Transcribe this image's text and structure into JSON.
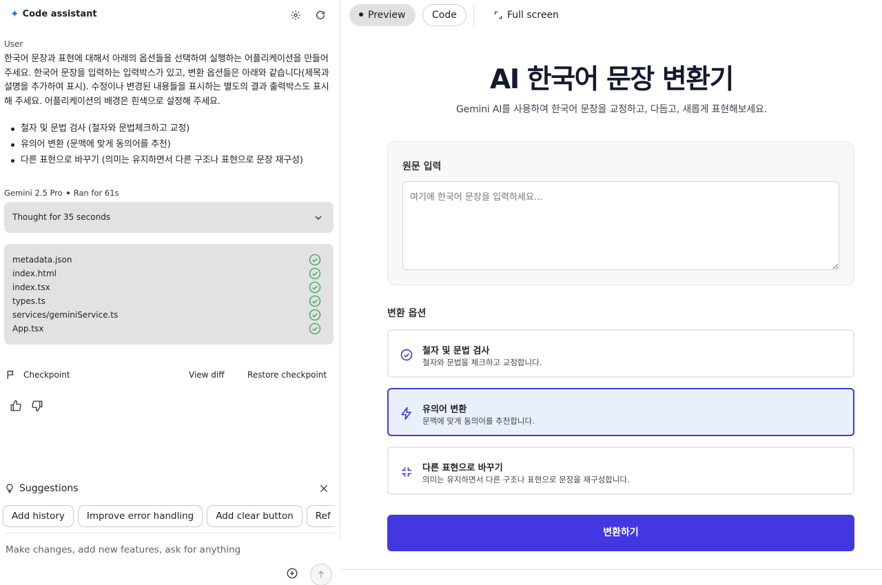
{
  "left": {
    "header": {
      "title": "Code assistant",
      "icons": [
        "settings-icon",
        "refresh-icon"
      ]
    },
    "user_label": "User",
    "user_message": "한국어 문장과 표현에 대해서 아래의 옵션들을 선택하여 실행하는 어플리케이션을 만들어 주세요. 한국어 문장을 입력하는 입력박스가 있고, 변환 옵션들은 아래와 같습니다(제목과 설명을 추가하여 표시). 수정이나 변경된 내용들을 표시하는 별도의 결과 출력박스도 표시해 주세요. 어플리케이션의 배경은 흰색으로 설정해 주세요.",
    "user_list": [
      "철자 및 문법 검사 (철자와 문법체크하고 교정)",
      "유의어 변환 (문맥에 맞게 동의어를 추천)",
      "다른 표현으로 바꾸기 (의미는 유지하면서 다른 구조나 표현으로 문장 재구성)"
    ],
    "model": "Gemini 2.5 Pro",
    "ran_for": "Ran for 61s",
    "thought": "Thought for 35 seconds",
    "files": [
      "metadata.json",
      "index.html",
      "index.tsx",
      "types.ts",
      "services/geminiService.ts",
      "App.tsx"
    ],
    "checkpoint": {
      "label": "Checkpoint",
      "view_diff": "View diff",
      "restore": "Restore checkpoint"
    },
    "suggestions": {
      "label": "Suggestions",
      "chips": [
        "Add history",
        "Improve error handling",
        "Add clear button",
        "Ref"
      ]
    },
    "compose": {
      "placeholder": "Make changes, add new features, ask for anything"
    }
  },
  "right": {
    "tabs": {
      "preview": "Preview",
      "code": "Code",
      "fullscreen": "Full screen"
    },
    "app": {
      "title": "AI 한국어 문장 변환기",
      "subtitle": "Gemini AI를 사용하여 한국어 문장을 교정하고, 다듬고, 새롭게 표현해보세요.",
      "input_label": "원문 입력",
      "input_placeholder": "여기에 한국어 문장을 입력하세요...",
      "options_label": "변환 옵션",
      "options": [
        {
          "title": "철자 및 문법 검사",
          "desc": "철자와 문법을 체크하고 교정합니다.",
          "icon": "check-circle-icon",
          "selected": false
        },
        {
          "title": "유의어 변환",
          "desc": "문맥에 맞게 동의어를 추천합니다.",
          "icon": "lightning-icon",
          "selected": true
        },
        {
          "title": "다른 표현으로 바꾸기",
          "desc": "의미는 유지하면서 다른 구조나 표현으로 문장을 재구성합니다.",
          "icon": "shrink-arrows-icon",
          "selected": false
        }
      ],
      "submit": "변환하기"
    }
  },
  "colors": {
    "accent": "#4338e0",
    "selected_bg": "#eaf0fb",
    "check_green": "#34a853",
    "spark_blue": "#1a73e8"
  }
}
